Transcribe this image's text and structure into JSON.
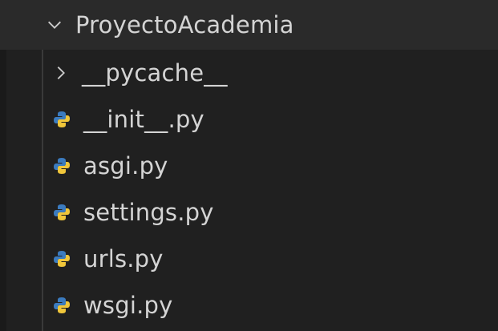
{
  "explorer": {
    "root_folder": {
      "name": "ProyectoAcademia",
      "expanded": true,
      "icon": "chevron-down-icon"
    },
    "items": [
      {
        "name": "__pycache__",
        "type": "folder",
        "icon": "chevron-right-icon"
      },
      {
        "name": "__init__.py",
        "type": "file",
        "icon": "python-icon"
      },
      {
        "name": "asgi.py",
        "type": "file",
        "icon": "python-icon"
      },
      {
        "name": "settings.py",
        "type": "file",
        "icon": "python-icon"
      },
      {
        "name": "urls.py",
        "type": "file",
        "icon": "python-icon"
      },
      {
        "name": "wsgi.py",
        "type": "file",
        "icon": "python-icon"
      }
    ],
    "colors": {
      "background": "#202020",
      "root_row_bg": "#2a2a2a",
      "text": "#d4d4d4",
      "python_blue": "#3b7bbf",
      "python_yellow": "#f0c63a"
    }
  }
}
